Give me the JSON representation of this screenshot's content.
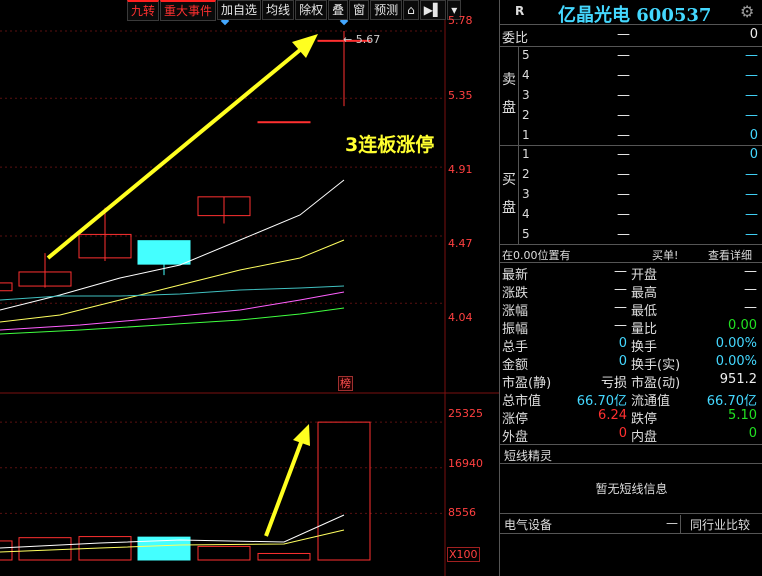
{
  "toolbar": {
    "items": [
      "九转",
      "重大事件",
      "加自选",
      "均线",
      "除权",
      "叠",
      "窗",
      "预测"
    ],
    "lock_icon": "lock-icon",
    "flag_icon": "flag-icon",
    "dropdown_icon": "chevron-down-icon"
  },
  "chart": {
    "price_axis": [
      "5.78",
      "5.35",
      "4.91",
      "4.47",
      "4.04"
    ],
    "volume_axis": [
      "25325",
      "16940",
      "8556"
    ],
    "volume_unit": "X100",
    "max_marker": "5.67",
    "annotation": "3连板涨停",
    "rank_badge": "榜",
    "colors": {
      "up": "#ff3030",
      "down": "#44ffff",
      "arrow": "#ffff20",
      "grid": "#5a1010"
    }
  },
  "chart_data": {
    "type": "candlestick",
    "candles": [
      {
        "open": 4.12,
        "close": 4.17,
        "high": 4.19,
        "low": 4.1
      },
      {
        "open": 4.15,
        "close": 4.24,
        "high": 4.36,
        "low": 4.14
      },
      {
        "open": 4.33,
        "close": 4.48,
        "high": 4.65,
        "low": 4.31
      },
      {
        "open": 4.44,
        "close": 4.29,
        "high": 4.44,
        "low": 4.22
      },
      {
        "open": 4.6,
        "close": 4.72,
        "high": 4.72,
        "low": 4.55
      },
      {
        "open": 5.2,
        "close": 5.2,
        "high": 5.2,
        "low": 5.2
      },
      {
        "open": 5.72,
        "close": 5.72,
        "high": 5.78,
        "low": 5.3
      }
    ],
    "volumes": [
      3500,
      4100,
      4300,
      4200,
      2500,
      1200,
      25325
    ],
    "volume_up": [
      true,
      true,
      true,
      false,
      true,
      true,
      true
    ],
    "ylim": [
      3.85,
      5.85
    ],
    "vol_ylim": [
      0,
      27000
    ]
  },
  "stock": {
    "market_badge": "R",
    "name": "亿晶光电 600537",
    "settings_icon": "gear-icon"
  },
  "orderbook": {
    "ratio_label": "委比",
    "ratio_value": "—",
    "ratio_right": "0",
    "sell_label": "卖盘",
    "buy_label": "买盘",
    "sell": [
      {
        "level": "5",
        "price": "—",
        "vol": "—"
      },
      {
        "level": "4",
        "price": "—",
        "vol": "—"
      },
      {
        "level": "3",
        "price": "—",
        "vol": "—"
      },
      {
        "level": "2",
        "price": "—",
        "vol": "—"
      },
      {
        "level": "1",
        "price": "—",
        "vol": "0"
      }
    ],
    "buy": [
      {
        "level": "1",
        "price": "—",
        "vol": "0"
      },
      {
        "level": "2",
        "price": "—",
        "vol": "—"
      },
      {
        "level": "3",
        "price": "—",
        "vol": "—"
      },
      {
        "level": "4",
        "price": "—",
        "vol": "—"
      },
      {
        "level": "5",
        "price": "—",
        "vol": "—"
      }
    ]
  },
  "position_bar": {
    "left": "在0.00位置有",
    "mid": "买单!",
    "right": "查看详细"
  },
  "quote": [
    {
      "l1": "最新",
      "v1": "—",
      "l2": "开盘",
      "v2": "—",
      "c1": "white",
      "c2": "white"
    },
    {
      "l1": "涨跌",
      "v1": "—",
      "l2": "最高",
      "v2": "—",
      "c1": "white",
      "c2": "white"
    },
    {
      "l1": "涨幅",
      "v1": "—",
      "l2": "最低",
      "v2": "—",
      "c1": "white",
      "c2": "white"
    },
    {
      "l1": "振幅",
      "v1": "—",
      "l2": "量比",
      "v2": "0.00",
      "c1": "white",
      "c2": "green"
    },
    {
      "l1": "总手",
      "v1": "0",
      "l2": "换手",
      "v2": "0.00%",
      "c1": "cyan",
      "c2": "cyan"
    },
    {
      "l1": "金额",
      "v1": "0",
      "l2": "换手(实)",
      "v2": "0.00%",
      "c1": "cyan",
      "c2": "cyan"
    },
    {
      "l1": "市盈(静)",
      "v1": "亏损",
      "l2": "市盈(动)",
      "v2": "951.2",
      "c1": "white",
      "c2": "white"
    },
    {
      "l1": "总市值",
      "v1": "66.70亿",
      "l2": "流通值",
      "v2": "66.70亿",
      "c1": "cyan",
      "c2": "cyan"
    },
    {
      "l1": "涨停",
      "v1": "6.24",
      "l2": "跌停",
      "v2": "5.10",
      "c1": "red",
      "c2": "green"
    },
    {
      "l1": "外盘",
      "v1": "0",
      "l2": "内盘",
      "v2": "0",
      "c1": "red",
      "c2": "green"
    }
  ],
  "short_line": {
    "title": "短线精灵",
    "message": "暂无短线信息"
  },
  "footer": {
    "sector": "电气设备",
    "minimize": "—",
    "compare": "同行业比较"
  }
}
